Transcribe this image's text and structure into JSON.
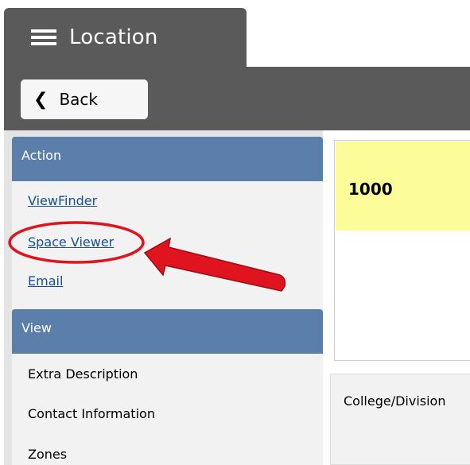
{
  "tab": {
    "title": "Location",
    "menu_icon": "hamburger-icon"
  },
  "toolbar": {
    "back_label": "Back",
    "back_icon": "chevron-left-icon"
  },
  "sidebar": {
    "action_header": "Action",
    "action_items": [
      "ViewFinder",
      "Space Viewer",
      "Email"
    ],
    "view_header": "View",
    "view_items": [
      "Extra Description",
      "Contact Information",
      "Zones"
    ]
  },
  "detail": {
    "code": "1000",
    "college_label": "College/Division"
  },
  "colors": {
    "header_bar": "#5a5a5a",
    "section_header": "#5b7eab",
    "link": "#1a4e93",
    "highlight_card": "#fcfc99",
    "annotation": "#e0141e"
  }
}
